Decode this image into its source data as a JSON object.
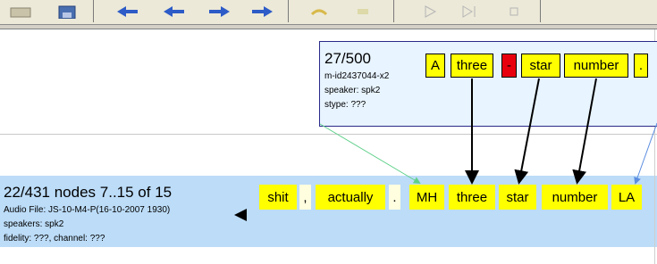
{
  "toolbar": {
    "buttons": [
      "open-icon",
      "save-icon",
      "first-icon",
      "previous-icon",
      "next-icon",
      "last-icon",
      "undo-icon",
      "edit-icon",
      "play-icon",
      "play-to-end-icon",
      "stop-icon"
    ]
  },
  "upper": {
    "count": "27/500",
    "id": "m-id2437044-x2",
    "speaker": "speaker: spk2",
    "stype": "stype: ???",
    "tokens": [
      {
        "text": "A",
        "color": "#ffff00"
      },
      {
        "text": "three",
        "color": "#ffff00"
      },
      {
        "text": "-",
        "color": "#e8000d"
      },
      {
        "text": "star",
        "color": "#ffff00"
      },
      {
        "text": "number",
        "color": "#ffff00"
      },
      {
        "text": ".",
        "color": "#ffff00"
      }
    ]
  },
  "lower": {
    "count": "22/431 nodes 7..15 of 15",
    "audio": "Audio File: JS-10-M4-P(16-10-2007 1930)",
    "speakers": "speakers: spk2",
    "fidelity": "fidelity: ???, channel: ???",
    "tokens": [
      {
        "text": "shit",
        "color": "#ffff00"
      },
      {
        "text": ",",
        "color": "#ffffe0"
      },
      {
        "text": "actually",
        "color": "#ffff00"
      },
      {
        "text": ".",
        "color": "#ffffe0"
      },
      {
        "text": "MH",
        "color": "#ffff00"
      },
      {
        "text": "three",
        "color": "#ffff00"
      },
      {
        "text": "star",
        "color": "#ffff00"
      },
      {
        "text": "number",
        "color": "#ffff00"
      },
      {
        "text": "LA",
        "color": "#ffff00"
      }
    ]
  },
  "colors": {
    "lower_background": "#bcdcf8",
    "upper_box_background": "#e8f4ff",
    "link_green": "#5fd08a",
    "link_blue": "#5b8de0",
    "link_black": "#000000"
  }
}
